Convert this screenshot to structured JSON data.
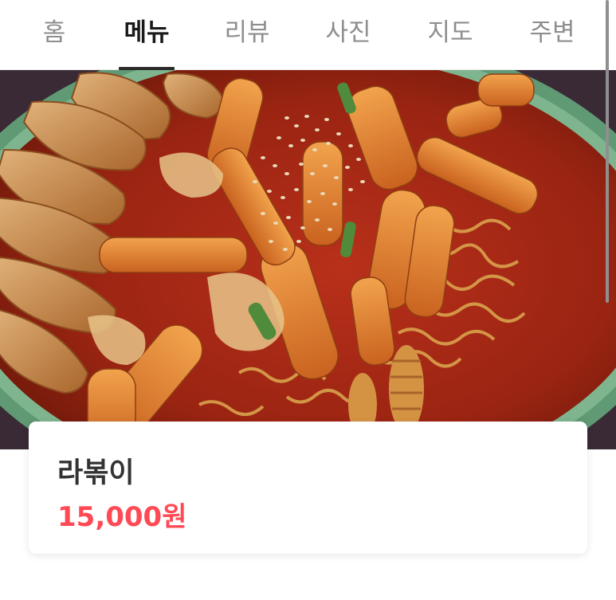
{
  "tabs": [
    {
      "label": "홈",
      "active": false
    },
    {
      "label": "메뉴",
      "active": true
    },
    {
      "label": "리뷰",
      "active": false
    },
    {
      "label": "사진",
      "active": false
    },
    {
      "label": "지도",
      "active": false
    },
    {
      "label": "주변",
      "active": false
    }
  ],
  "menu_item": {
    "name": "라볶이",
    "price": "15,000원"
  },
  "colors": {
    "price": "#ff4a55",
    "active_tab": "#1a1a1a",
    "inactive_tab": "#8e8e8e"
  }
}
